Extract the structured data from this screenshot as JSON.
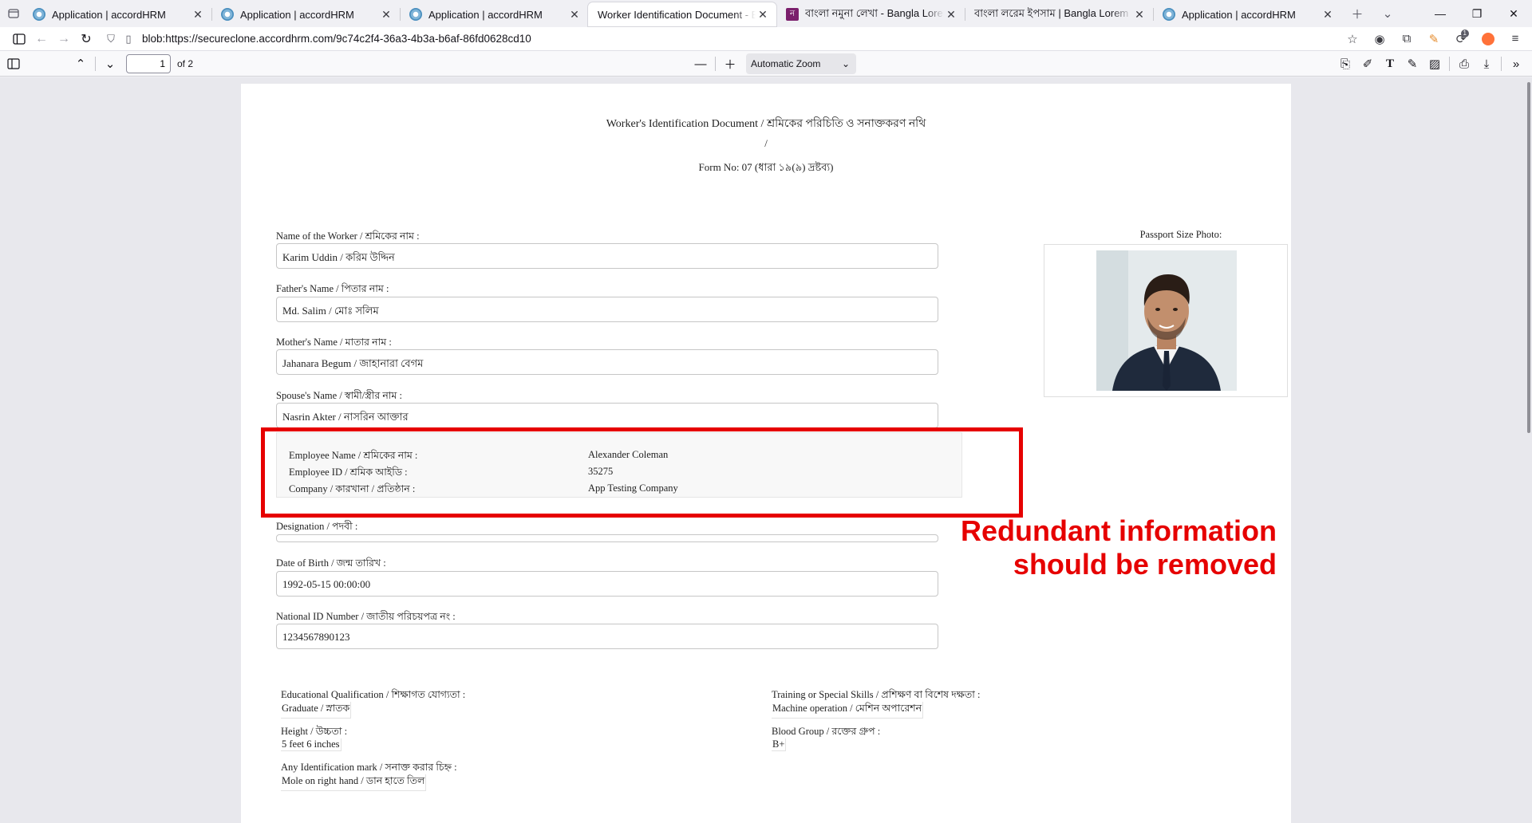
{
  "browser": {
    "tabs": [
      {
        "title": "Application | accordHRM",
        "favicon": "accordhrm-logo"
      },
      {
        "title": "Application | accordHRM",
        "favicon": "accordhrm-logo"
      },
      {
        "title": "Application | accordHRM",
        "favicon": "accordhrm-logo"
      },
      {
        "title": "Worker Identification Document - Emp",
        "favicon": "none",
        "active": true
      },
      {
        "title": "বাংলা নমুনা লেখা - Bangla Lorem Ip",
        "favicon": "bangla-logo",
        "favicon_letter": "ন"
      },
      {
        "title": "বাংলা লরেম ইপসাম | Bangla Lorem Ip",
        "favicon": "none"
      },
      {
        "title": "Application | accordHRM",
        "favicon": "accordhrm-logo"
      }
    ],
    "url": "blob:https://secureclone.accordhrm.com/9c74c2f4-36a3-4b3a-b6af-86fd0628cd10",
    "extension_badge": "1"
  },
  "pdf_viewer": {
    "current_page": "1",
    "page_count": "of 2",
    "zoom": "Automatic Zoom"
  },
  "document": {
    "title": "Worker's Identification Document / শ্রমিকের পরিচিতি ও সনাক্তকরণ নথি",
    "subtitle_separator": "/",
    "form_no": "Form No: 07 (ধারা ১৯(৯) দ্রষ্টব্য)",
    "photo_label": "Passport Size Photo:",
    "fields": {
      "name": {
        "label": "Name of the Worker / শ্রমিকের নাম :",
        "value": "Karim Uddin / করিম উদ্দিন"
      },
      "father": {
        "label": "Father's Name / পিতার নাম :",
        "value": "Md. Salim / মোঃ সলিম"
      },
      "mother": {
        "label": "Mother's Name / মাতার নাম :",
        "value": "Jahanara Begum / জাহানারা বেগম"
      },
      "spouse": {
        "label": "Spouse's Name / স্বামী/স্ত্রীর নাম :",
        "value": "Nasrin Akter / নাসরিন আক্তার"
      },
      "designation": {
        "label": "Designation / পদবী :",
        "value": ""
      },
      "dob": {
        "label": "Date of Birth / জন্ম তারিখ :",
        "value": "1992-05-15 00:00:00"
      },
      "nid": {
        "label": "National ID Number / জাতীয় পরিচয়পত্র নং :",
        "value": "1234567890123"
      }
    },
    "employee_info": {
      "name_label": "Employee Name / শ্রমিকের নাম :",
      "name_value": "Alexander Coleman",
      "id_label": "Employee ID / শ্রমিক আইডি :",
      "id_value": "35275",
      "company_label": "Company / কারখানা / প্রতিষ্ঠান :",
      "company_value": "App Testing Company"
    },
    "extra": {
      "education_label": "Educational Qualification / শিক্ষাগত যোগ্যতা :",
      "education_value": "Graduate / স্নাতক",
      "training_label": "Training or Special Skills / প্রশিক্ষণ বা বিশেষ দক্ষতা :",
      "training_value": "Machine operation / মেশিন অপারেশন",
      "height_label": "Height / উচ্চতা :",
      "height_value": "5 feet 6 inches",
      "blood_label": "Blood Group / রক্তের গ্রুপ :",
      "blood_value": "B+",
      "mark_label": "Any Identification mark / সনাক্ত করার চিহ্ন :",
      "mark_value": "Mole on right hand / ডান হাতে তিল"
    }
  },
  "annotation": {
    "text_line1": "Redundant information",
    "text_line2": "should be removed",
    "color": "#e60000"
  }
}
